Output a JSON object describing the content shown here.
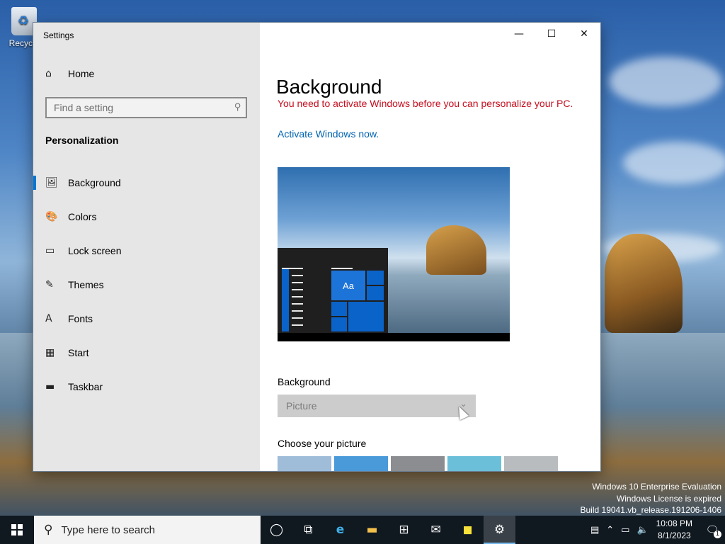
{
  "desktop": {
    "recycle_bin_label": "Recycle",
    "watermark": [
      "Windows 10 Enterprise Evaluation",
      "Windows License is expired",
      "Build 19041.vb_release.191206-1406"
    ]
  },
  "window": {
    "title": "Settings",
    "controls": {
      "minimize": "—",
      "maximize": "☐",
      "close": "✕"
    }
  },
  "sidebar": {
    "home_label": "Home",
    "search_placeholder": "Find a setting",
    "section_heading": "Personalization",
    "items": [
      {
        "label": "Background",
        "icon": "picture-icon",
        "glyph": "🖼",
        "active": true
      },
      {
        "label": "Colors",
        "icon": "palette-icon",
        "glyph": "🎨",
        "active": false
      },
      {
        "label": "Lock screen",
        "icon": "lock-screen-icon",
        "glyph": "▭",
        "active": false
      },
      {
        "label": "Themes",
        "icon": "themes-icon",
        "glyph": "✎",
        "active": false
      },
      {
        "label": "Fonts",
        "icon": "fonts-icon",
        "glyph": "A",
        "active": false
      },
      {
        "label": "Start",
        "icon": "start-icon",
        "glyph": "▦",
        "active": false
      },
      {
        "label": "Taskbar",
        "icon": "taskbar-icon",
        "glyph": "▬",
        "active": false
      }
    ]
  },
  "main": {
    "title": "Background",
    "warning": "You need to activate Windows before you can personalize your PC.",
    "activate_link": "Activate Windows now.",
    "preview_tile_text": "Aa",
    "background_label": "Background",
    "background_value": "Picture",
    "choose_label": "Choose your picture",
    "thumb_colors": [
      "#9fbcd8",
      "#4a9ad9",
      "#8b8d90",
      "#6bbfd8",
      "#b9bcbf"
    ]
  },
  "taskbar": {
    "search_placeholder": "Type here to search",
    "clock_time": "10:08 PM",
    "clock_date": "8/1/2023",
    "notification_count": "1",
    "apps": [
      {
        "name": "cortana-icon",
        "glyph": "◯"
      },
      {
        "name": "task-view-icon",
        "glyph": "⧉"
      },
      {
        "name": "edge-icon",
        "glyph": "e"
      },
      {
        "name": "file-explorer-icon",
        "glyph": "▬"
      },
      {
        "name": "store-icon",
        "glyph": "⊞"
      },
      {
        "name": "mail-icon",
        "glyph": "✉"
      },
      {
        "name": "sticky-notes-icon",
        "glyph": "◼"
      },
      {
        "name": "settings-icon",
        "glyph": "⚙"
      }
    ]
  }
}
